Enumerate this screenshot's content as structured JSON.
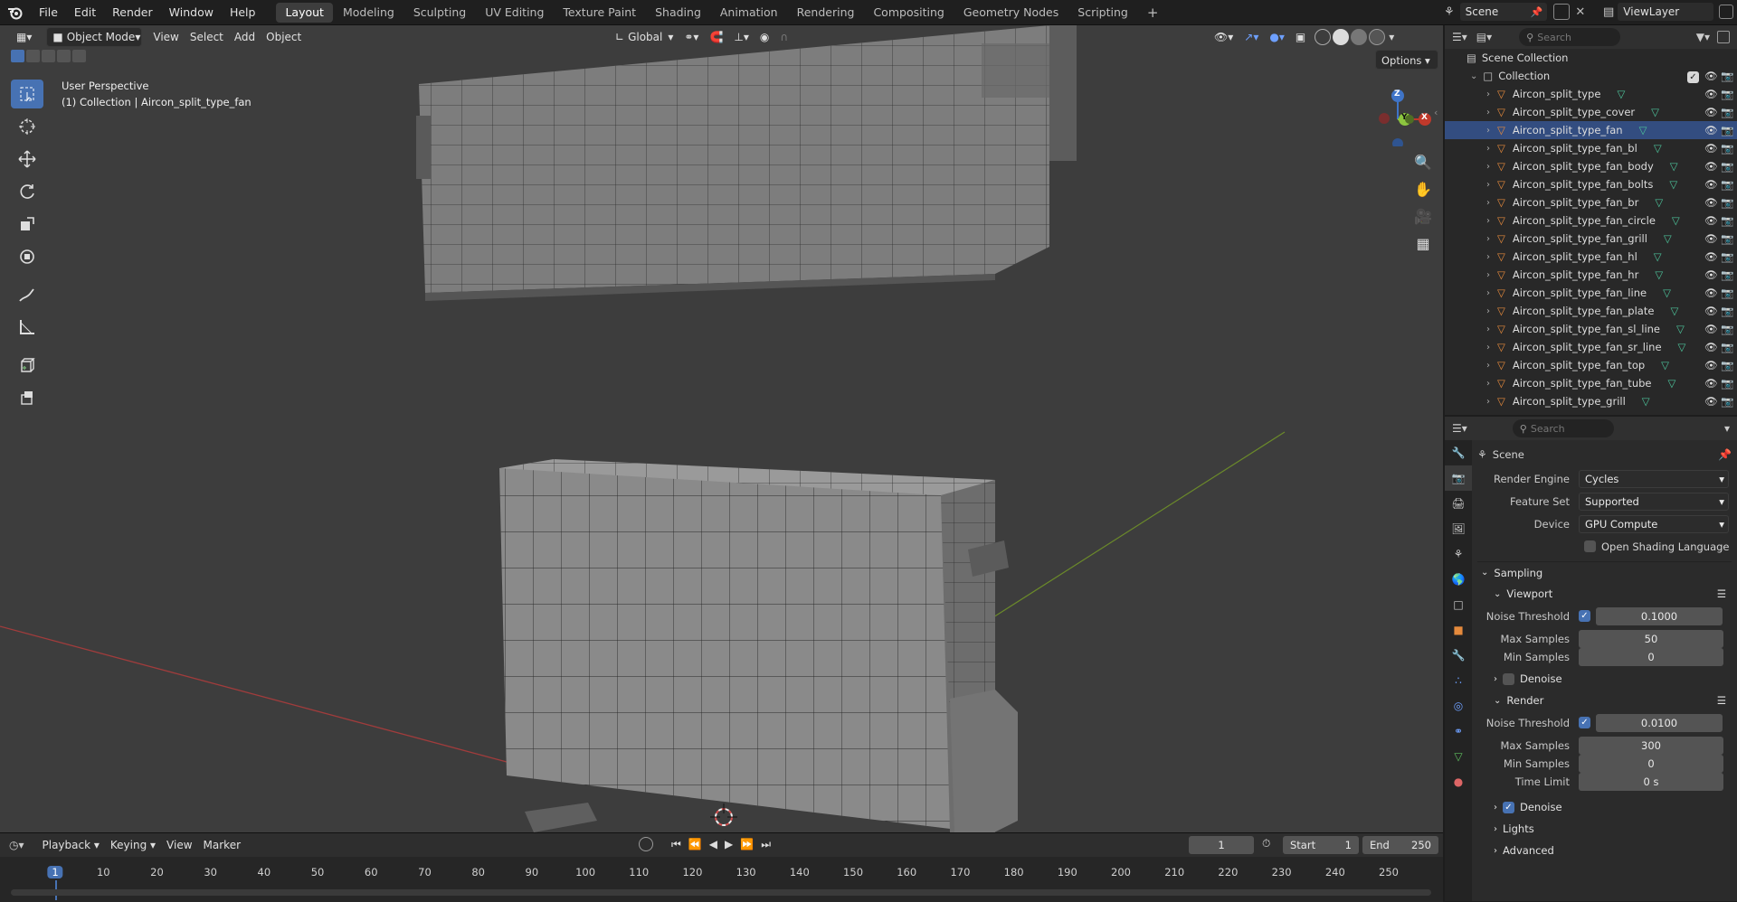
{
  "topbar": {
    "menus": [
      "File",
      "Edit",
      "Render",
      "Window",
      "Help"
    ],
    "workspaces": [
      "Layout",
      "Modeling",
      "Sculpting",
      "UV Editing",
      "Texture Paint",
      "Shading",
      "Animation",
      "Rendering",
      "Compositing",
      "Geometry Nodes",
      "Scripting"
    ],
    "active_workspace": "Layout",
    "add_tab": "+",
    "scene_name": "Scene",
    "view_layer": "ViewLayer"
  },
  "viewport_header": {
    "mode": "Object Mode",
    "menus": [
      "View",
      "Select",
      "Add",
      "Object"
    ],
    "orientation": "Global",
    "options": "Options"
  },
  "viewport": {
    "perspective": "User Perspective",
    "collection_info": "(1) Collection | Aircon_split_type_fan",
    "gizmo": {
      "z": "Z",
      "y": "Y",
      "x": "X"
    }
  },
  "outliner": {
    "search_placeholder": "Search",
    "root": "Scene Collection",
    "collection": "Collection",
    "items": [
      {
        "name": "Aircon_split_type",
        "selected": false
      },
      {
        "name": "Aircon_split_type_cover",
        "selected": false
      },
      {
        "name": "Aircon_split_type_fan",
        "selected": true
      },
      {
        "name": "Aircon_split_type_fan_bl",
        "selected": false
      },
      {
        "name": "Aircon_split_type_fan_body",
        "selected": false
      },
      {
        "name": "Aircon_split_type_fan_bolts",
        "selected": false
      },
      {
        "name": "Aircon_split_type_fan_br",
        "selected": false
      },
      {
        "name": "Aircon_split_type_fan_circle",
        "selected": false
      },
      {
        "name": "Aircon_split_type_fan_grill",
        "selected": false
      },
      {
        "name": "Aircon_split_type_fan_hl",
        "selected": false
      },
      {
        "name": "Aircon_split_type_fan_hr",
        "selected": false
      },
      {
        "name": "Aircon_split_type_fan_line",
        "selected": false
      },
      {
        "name": "Aircon_split_type_fan_plate",
        "selected": false
      },
      {
        "name": "Aircon_split_type_fan_sl_line",
        "selected": false
      },
      {
        "name": "Aircon_split_type_fan_sr_line",
        "selected": false
      },
      {
        "name": "Aircon_split_type_fan_top",
        "selected": false
      },
      {
        "name": "Aircon_split_type_fan_tube",
        "selected": false
      },
      {
        "name": "Aircon_split_type_grill",
        "selected": false
      }
    ]
  },
  "properties": {
    "search_placeholder": "Search",
    "context": "Scene",
    "render_engine": {
      "label": "Render Engine",
      "value": "Cycles"
    },
    "feature_set": {
      "label": "Feature Set",
      "value": "Supported"
    },
    "device": {
      "label": "Device",
      "value": "GPU Compute"
    },
    "osl": {
      "label": "Open Shading Language",
      "checked": false
    },
    "sampling": "Sampling",
    "viewport": {
      "title": "Viewport",
      "noise_threshold": {
        "label": "Noise Threshold",
        "value": "0.1000"
      },
      "max_samples": {
        "label": "Max Samples",
        "value": "50"
      },
      "min_samples": {
        "label": "Min Samples",
        "value": "0"
      },
      "denoise": "Denoise"
    },
    "render": {
      "title": "Render",
      "noise_threshold": {
        "label": "Noise Threshold",
        "value": "0.0100"
      },
      "max_samples": {
        "label": "Max Samples",
        "value": "300"
      },
      "min_samples": {
        "label": "Min Samples",
        "value": "0"
      },
      "time_limit": {
        "label": "Time Limit",
        "value": "0 s"
      },
      "denoise": "Denoise"
    },
    "lights": "Lights",
    "advanced": "Advanced"
  },
  "timeline": {
    "menus": [
      "Playback",
      "Keying",
      "View",
      "Marker"
    ],
    "current_frame": "1",
    "start_label": "Start",
    "start": "1",
    "end_label": "End",
    "end": "250",
    "ticks": [
      "1",
      "10",
      "20",
      "30",
      "40",
      "50",
      "60",
      "70",
      "80",
      "90",
      "100",
      "110",
      "120",
      "130",
      "140",
      "150",
      "160",
      "170",
      "180",
      "190",
      "200",
      "210",
      "220",
      "230",
      "240",
      "250"
    ]
  }
}
